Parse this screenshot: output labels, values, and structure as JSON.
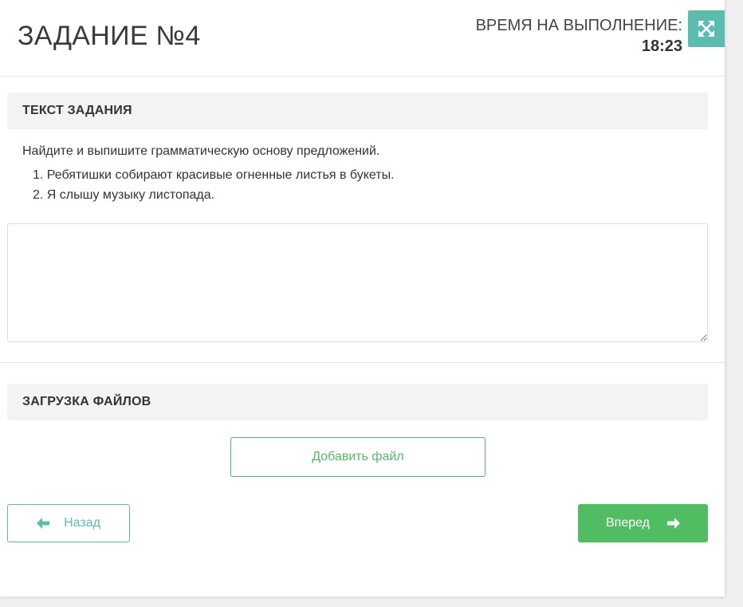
{
  "header": {
    "task_title": "ЗАДАНИЕ №4",
    "timer_label": "ВРЕМЯ НА ВЫПОЛНЕНИЕ:",
    "timer_value": "18:23",
    "fullscreen_icon": "expand-arrows-icon"
  },
  "task_section": {
    "title": "ТЕКСТ ЗАДАНИЯ",
    "instruction": "Найдите и выпишите грамматическую основу предложений.",
    "items": [
      "1. Ребятишки собирают красивые огненные листья в букеты.",
      "2. Я слышу музыку листопада."
    ]
  },
  "answer": {
    "value": ""
  },
  "files_section": {
    "title": "ЗАГРУЗКА ФАЙЛОВ",
    "add_file_label": "Добавить файл"
  },
  "navigation": {
    "back_label": "Назад",
    "back_icon": "arrow-left-icon",
    "next_label": "Вперед",
    "next_icon": "arrow-right-icon"
  },
  "colors": {
    "accent_teal": "#5bbdae",
    "accent_green": "#51bd63",
    "section_bg": "#f2f3f5"
  }
}
